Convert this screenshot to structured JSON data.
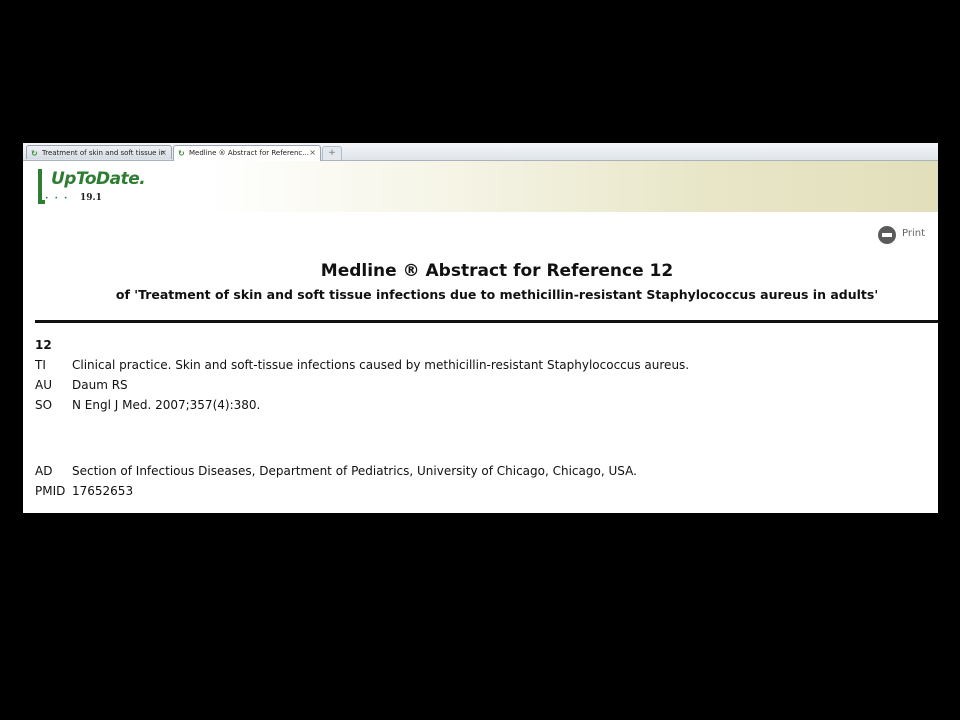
{
  "tabs": [
    {
      "label": "Treatment of skin and soft tissue inf...",
      "close": "×",
      "active": false
    },
    {
      "label": "Medline ® Abstract for Referenc...",
      "close": "×",
      "active": true
    }
  ],
  "new_tab_symbol": "+",
  "logo": {
    "text": "UpToDate.",
    "version": "19.1",
    "icon": "uptodate-clock-logo"
  },
  "print": {
    "label": "Print",
    "icon": "printer-icon"
  },
  "heading": {
    "title": "Medline ® Abstract for Reference 12",
    "subtitle": "of 'Treatment of skin and soft tissue infections due to methicillin-resistant Staphylococcus aureus in adults'"
  },
  "reference": {
    "number": "12",
    "fields": [
      {
        "key": "TI",
        "value": "Clinical practice. Skin and soft-tissue infections caused by methicillin-resistant Staphylococcus aureus."
      },
      {
        "key": "AU",
        "value": "Daum RS"
      },
      {
        "key": "SO",
        "value": "N Engl J Med. 2007;357(4):380."
      },
      {
        "key": "AD",
        "value": "Section of Infectious Diseases, Department of Pediatrics, University of Chicago, Chicago, USA."
      },
      {
        "key": "PMID",
        "value": "17652653"
      }
    ]
  },
  "colors": {
    "brand_green": "#2f7d32",
    "background": "#000000"
  }
}
